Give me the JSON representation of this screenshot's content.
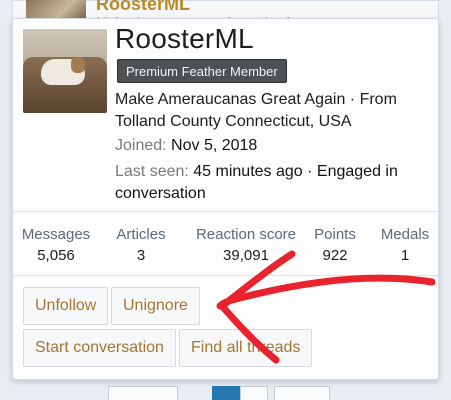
{
  "background": {
    "post_name": "RoosterML",
    "post_snippet": "Make Ameraucanas Great Again"
  },
  "card": {
    "username": "RoosterML",
    "badge": "Premium Feather Member",
    "custom_title": "Make Ameraucanas Great Again · From Tolland County Connecticut, USA",
    "joined_label": "Joined:",
    "joined_value": "Nov 5, 2018",
    "last_seen_label": "Last seen:",
    "last_seen_value": "45 minutes ago · Engaged in conversation",
    "stats": [
      {
        "label": "Messages",
        "value": "5,056"
      },
      {
        "label": "Articles",
        "value": "3"
      },
      {
        "label": "Reaction score",
        "value": "39,091"
      },
      {
        "label": "Points",
        "value": "922"
      },
      {
        "label": "Medals",
        "value": "1"
      }
    ],
    "buttons": {
      "unfollow": "Unfollow",
      "unignore": "Unignore",
      "start_conversation": "Start conversation",
      "find_threads": "Find all threads"
    }
  },
  "colors": {
    "link": "#a5762f",
    "badge_bg": "#4d5154",
    "annotation": "#e8232e"
  }
}
